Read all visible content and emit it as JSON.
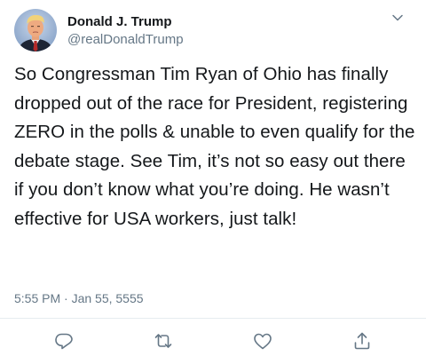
{
  "tweet": {
    "author": {
      "display_name": "Donald J. Trump",
      "handle": "@realDonaldTrump",
      "avatar_icon": "profile-avatar"
    },
    "text": "So Congressman Tim Ryan of Ohio has finally dropped out of the race for President, registering ZERO in the polls & unable to even qualify for the debate stage. See Tim, it’s not so easy out there if you don’t know what you’re doing. He wasn’t effective for USA workers, just talk!",
    "timestamp": "5:55 PM · Jan 55, 5555",
    "menu_icon": "chevron-down-icon",
    "actions": [
      {
        "name": "reply",
        "icon": "reply-icon"
      },
      {
        "name": "retweet",
        "icon": "retweet-icon"
      },
      {
        "name": "like",
        "icon": "heart-icon"
      },
      {
        "name": "share",
        "icon": "share-icon"
      }
    ]
  },
  "colors": {
    "text_primary": "#14171a",
    "text_secondary": "#657786",
    "icon": "#657786",
    "divider": "#e6ecf0",
    "background": "#ffffff"
  }
}
